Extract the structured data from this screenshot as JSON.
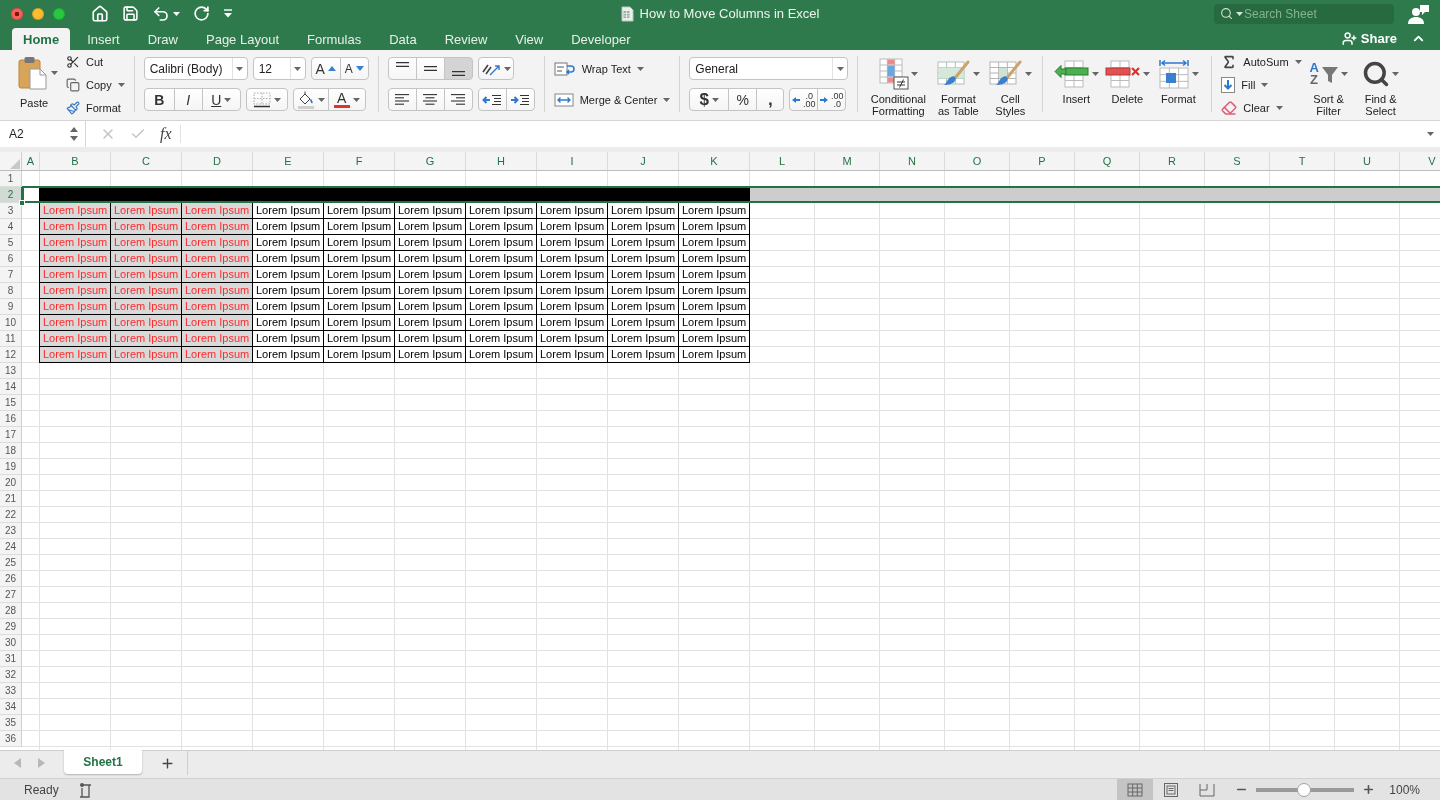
{
  "window": {
    "title": "How to Move Columns in Excel",
    "search": {
      "placeholder": "Search Sheet"
    }
  },
  "ribbon_tabs": [
    {
      "label": "Home",
      "selected": true
    },
    {
      "label": "Insert",
      "selected": false
    },
    {
      "label": "Draw",
      "selected": false
    },
    {
      "label": "Page Layout",
      "selected": false
    },
    {
      "label": "Formulas",
      "selected": false
    },
    {
      "label": "Data",
      "selected": false
    },
    {
      "label": "Review",
      "selected": false
    },
    {
      "label": "View",
      "selected": false
    },
    {
      "label": "Developer",
      "selected": false
    }
  ],
  "share": {
    "label": "Share"
  },
  "clipboard": {
    "paste": "Paste",
    "cut": "Cut",
    "copy": "Copy",
    "format": "Format"
  },
  "font": {
    "name": "Calibri (Body)",
    "size": "12",
    "grow": "A",
    "shrink": "A",
    "bold": "B",
    "italic": "I",
    "underline": "U",
    "color_button": "A"
  },
  "alignment": {
    "vertical": [
      {
        "kind": "top",
        "selected": false
      },
      {
        "kind": "middle",
        "selected": false
      },
      {
        "kind": "bottom",
        "selected": true
      }
    ],
    "horizontal": [
      {
        "kind": "left",
        "selected": false
      },
      {
        "kind": "center",
        "selected": false
      },
      {
        "kind": "right",
        "selected": false
      }
    ],
    "wrap_text": "Wrap Text",
    "merge": "Merge & Center"
  },
  "number": {
    "format": "General",
    "currency": "$",
    "percent": "%",
    "comma": ",",
    "increase_decimal": [
      ".0",
      ".00"
    ],
    "decrease_decimal": [
      ".00",
      ".0"
    ]
  },
  "styles": [
    {
      "kind": "conditional",
      "label": [
        "Conditional",
        "Formatting"
      ]
    },
    {
      "kind": "table",
      "label": [
        "Format",
        "as Table"
      ]
    },
    {
      "kind": "cell",
      "label": [
        "Cell",
        "Styles"
      ]
    }
  ],
  "cells_group": [
    {
      "kind": "insert",
      "label": [
        "Insert"
      ]
    },
    {
      "kind": "delete",
      "label": [
        "Delete"
      ]
    },
    {
      "kind": "format",
      "label": [
        "Format"
      ]
    }
  ],
  "editing": {
    "autosum": "AutoSum",
    "fill": "Fill",
    "clear": "Clear",
    "sort": {
      "letters": [
        "A",
        "Z"
      ],
      "label": [
        "Sort &",
        "Filter"
      ]
    },
    "find": {
      "label": [
        "Find &",
        "Select"
      ]
    }
  },
  "formula_bar": {
    "name_box": "A2",
    "function_label": "fx"
  },
  "columns": [
    "A",
    "B",
    "C",
    "D",
    "E",
    "F",
    "G",
    "H",
    "I",
    "J",
    "K",
    "L",
    "M",
    "N",
    "O",
    "P",
    "Q",
    "R",
    "S",
    "T",
    "U",
    "V"
  ],
  "rows": [
    {
      "label": "1",
      "selected": false
    },
    {
      "label": "2",
      "selected": true,
      "cells": [
        {
          "kind": "black"
        },
        {
          "kind": "black"
        },
        {
          "kind": "black"
        },
        {
          "kind": "black"
        },
        {
          "kind": "black"
        },
        {
          "kind": "black"
        },
        {
          "kind": "black"
        },
        {
          "kind": "black"
        },
        {
          "kind": "black"
        },
        {
          "kind": "black"
        }
      ]
    },
    {
      "label": "3",
      "selected": false,
      "cells": [
        {
          "kind": "shaded",
          "text": "Lorem Ipsum"
        },
        {
          "kind": "shaded",
          "text": "Lorem Ipsum"
        },
        {
          "kind": "shaded",
          "text": "Lorem Ipsum"
        },
        {
          "kind": "plain",
          "text": "Lorem Ipsum"
        },
        {
          "kind": "plain",
          "text": "Lorem Ipsum"
        },
        {
          "kind": "plain",
          "text": "Lorem Ipsum"
        },
        {
          "kind": "plain",
          "text": "Lorem Ipsum"
        },
        {
          "kind": "plain",
          "text": "Lorem Ipsum"
        },
        {
          "kind": "plain",
          "text": "Lorem Ipsum"
        },
        {
          "kind": "plain",
          "text": "Lorem Ipsum"
        }
      ]
    },
    {
      "label": "4",
      "selected": false,
      "cells": [
        {
          "kind": "shaded",
          "text": "Lorem Ipsum"
        },
        {
          "kind": "shaded",
          "text": "Lorem Ipsum"
        },
        {
          "kind": "shaded",
          "text": "Lorem Ipsum"
        },
        {
          "kind": "plain",
          "text": "Lorem Ipsum"
        },
        {
          "kind": "plain",
          "text": "Lorem Ipsum"
        },
        {
          "kind": "plain",
          "text": "Lorem Ipsum"
        },
        {
          "kind": "plain",
          "text": "Lorem Ipsum"
        },
        {
          "kind": "plain",
          "text": "Lorem Ipsum"
        },
        {
          "kind": "plain",
          "text": "Lorem Ipsum"
        },
        {
          "kind": "plain",
          "text": "Lorem Ipsum"
        }
      ]
    },
    {
      "label": "5",
      "selected": false,
      "cells": [
        {
          "kind": "shaded",
          "text": "Lorem Ipsum"
        },
        {
          "kind": "shaded",
          "text": "Lorem Ipsum"
        },
        {
          "kind": "shaded",
          "text": "Lorem Ipsum"
        },
        {
          "kind": "plain",
          "text": "Lorem Ipsum"
        },
        {
          "kind": "plain",
          "text": "Lorem Ipsum"
        },
        {
          "kind": "plain",
          "text": "Lorem Ipsum"
        },
        {
          "kind": "plain",
          "text": "Lorem Ipsum"
        },
        {
          "kind": "plain",
          "text": "Lorem Ipsum"
        },
        {
          "kind": "plain",
          "text": "Lorem Ipsum"
        },
        {
          "kind": "plain",
          "text": "Lorem Ipsum"
        }
      ]
    },
    {
      "label": "6",
      "selected": false,
      "cells": [
        {
          "kind": "shaded",
          "text": "Lorem Ipsum"
        },
        {
          "kind": "shaded",
          "text": "Lorem Ipsum"
        },
        {
          "kind": "shaded",
          "text": "Lorem Ipsum"
        },
        {
          "kind": "plain",
          "text": "Lorem Ipsum"
        },
        {
          "kind": "plain",
          "text": "Lorem Ipsum"
        },
        {
          "kind": "plain",
          "text": "Lorem Ipsum"
        },
        {
          "kind": "plain",
          "text": "Lorem Ipsum"
        },
        {
          "kind": "plain",
          "text": "Lorem Ipsum"
        },
        {
          "kind": "plain",
          "text": "Lorem Ipsum"
        },
        {
          "kind": "plain",
          "text": "Lorem Ipsum"
        }
      ]
    },
    {
      "label": "7",
      "selected": false,
      "cells": [
        {
          "kind": "shaded",
          "text": "Lorem Ipsum"
        },
        {
          "kind": "shaded",
          "text": "Lorem Ipsum"
        },
        {
          "kind": "shaded",
          "text": "Lorem Ipsum"
        },
        {
          "kind": "plain",
          "text": "Lorem Ipsum"
        },
        {
          "kind": "plain",
          "text": "Lorem Ipsum"
        },
        {
          "kind": "plain",
          "text": "Lorem Ipsum"
        },
        {
          "kind": "plain",
          "text": "Lorem Ipsum"
        },
        {
          "kind": "plain",
          "text": "Lorem Ipsum"
        },
        {
          "kind": "plain",
          "text": "Lorem Ipsum"
        },
        {
          "kind": "plain",
          "text": "Lorem Ipsum"
        }
      ]
    },
    {
      "label": "8",
      "selected": false,
      "cells": [
        {
          "kind": "shaded",
          "text": "Lorem Ipsum"
        },
        {
          "kind": "shaded",
          "text": "Lorem Ipsum"
        },
        {
          "kind": "shaded",
          "text": "Lorem Ipsum"
        },
        {
          "kind": "plain",
          "text": "Lorem Ipsum"
        },
        {
          "kind": "plain",
          "text": "Lorem Ipsum"
        },
        {
          "kind": "plain",
          "text": "Lorem Ipsum"
        },
        {
          "kind": "plain",
          "text": "Lorem Ipsum"
        },
        {
          "kind": "plain",
          "text": "Lorem Ipsum"
        },
        {
          "kind": "plain",
          "text": "Lorem Ipsum"
        },
        {
          "kind": "plain",
          "text": "Lorem Ipsum"
        }
      ]
    },
    {
      "label": "9",
      "selected": false,
      "cells": [
        {
          "kind": "shaded",
          "text": "Lorem Ipsum"
        },
        {
          "kind": "shaded",
          "text": "Lorem Ipsum"
        },
        {
          "kind": "shaded",
          "text": "Lorem Ipsum"
        },
        {
          "kind": "plain",
          "text": "Lorem Ipsum"
        },
        {
          "kind": "plain",
          "text": "Lorem Ipsum"
        },
        {
          "kind": "plain",
          "text": "Lorem Ipsum"
        },
        {
          "kind": "plain",
          "text": "Lorem Ipsum"
        },
        {
          "kind": "plain",
          "text": "Lorem Ipsum"
        },
        {
          "kind": "plain",
          "text": "Lorem Ipsum"
        },
        {
          "kind": "plain",
          "text": "Lorem Ipsum"
        }
      ]
    },
    {
      "label": "10",
      "selected": false,
      "cells": [
        {
          "kind": "shaded",
          "text": "Lorem Ipsum"
        },
        {
          "kind": "shaded",
          "text": "Lorem Ipsum"
        },
        {
          "kind": "shaded",
          "text": "Lorem Ipsum"
        },
        {
          "kind": "plain",
          "text": "Lorem Ipsum"
        },
        {
          "kind": "plain",
          "text": "Lorem Ipsum"
        },
        {
          "kind": "plain",
          "text": "Lorem Ipsum"
        },
        {
          "kind": "plain",
          "text": "Lorem Ipsum"
        },
        {
          "kind": "plain",
          "text": "Lorem Ipsum"
        },
        {
          "kind": "plain",
          "text": "Lorem Ipsum"
        },
        {
          "kind": "plain",
          "text": "Lorem Ipsum"
        }
      ]
    },
    {
      "label": "11",
      "selected": false,
      "cells": [
        {
          "kind": "shaded",
          "text": "Lorem Ipsum"
        },
        {
          "kind": "shaded",
          "text": "Lorem Ipsum"
        },
        {
          "kind": "shaded",
          "text": "Lorem Ipsum"
        },
        {
          "kind": "plain",
          "text": "Lorem Ipsum"
        },
        {
          "kind": "plain",
          "text": "Lorem Ipsum"
        },
        {
          "kind": "plain",
          "text": "Lorem Ipsum"
        },
        {
          "kind": "plain",
          "text": "Lorem Ipsum"
        },
        {
          "kind": "plain",
          "text": "Lorem Ipsum"
        },
        {
          "kind": "plain",
          "text": "Lorem Ipsum"
        },
        {
          "kind": "plain",
          "text": "Lorem Ipsum"
        }
      ]
    },
    {
      "label": "12",
      "selected": false,
      "cells": [
        {
          "kind": "shaded",
          "text": "Lorem Ipsum"
        },
        {
          "kind": "shaded",
          "text": "Lorem Ipsum"
        },
        {
          "kind": "shaded",
          "text": "Lorem Ipsum"
        },
        {
          "kind": "plain",
          "text": "Lorem Ipsum"
        },
        {
          "kind": "plain",
          "text": "Lorem Ipsum"
        },
        {
          "kind": "plain",
          "text": "Lorem Ipsum"
        },
        {
          "kind": "plain",
          "text": "Lorem Ipsum"
        },
        {
          "kind": "plain",
          "text": "Lorem Ipsum"
        },
        {
          "kind": "plain",
          "text": "Lorem Ipsum"
        },
        {
          "kind": "plain",
          "text": "Lorem Ipsum"
        }
      ]
    },
    {
      "label": "13",
      "selected": false
    },
    {
      "label": "14",
      "selected": false
    },
    {
      "label": "15",
      "selected": false
    },
    {
      "label": "16",
      "selected": false
    },
    {
      "label": "17",
      "selected": false
    },
    {
      "label": "18",
      "selected": false
    },
    {
      "label": "19",
      "selected": false
    },
    {
      "label": "20",
      "selected": false
    },
    {
      "label": "21",
      "selected": false
    },
    {
      "label": "22",
      "selected": false
    },
    {
      "label": "23",
      "selected": false
    },
    {
      "label": "24",
      "selected": false
    },
    {
      "label": "25",
      "selected": false
    },
    {
      "label": "26",
      "selected": false
    },
    {
      "label": "27",
      "selected": false
    },
    {
      "label": "28",
      "selected": false
    },
    {
      "label": "29",
      "selected": false
    },
    {
      "label": "30",
      "selected": false
    },
    {
      "label": "31",
      "selected": false
    },
    {
      "label": "32",
      "selected": false
    },
    {
      "label": "33",
      "selected": false
    },
    {
      "label": "34",
      "selected": false
    },
    {
      "label": "35",
      "selected": false
    },
    {
      "label": "36",
      "selected": false
    }
  ],
  "sheet_tabs": [
    {
      "label": "Sheet1",
      "selected": true
    }
  ],
  "status_bar": {
    "status": "Ready",
    "views": [
      {
        "kind": "normal",
        "selected": true
      },
      {
        "kind": "page_layout",
        "selected": false
      },
      {
        "kind": "page_break",
        "selected": false
      }
    ],
    "zoom": {
      "level": 0.49,
      "reading": "100%"
    }
  }
}
